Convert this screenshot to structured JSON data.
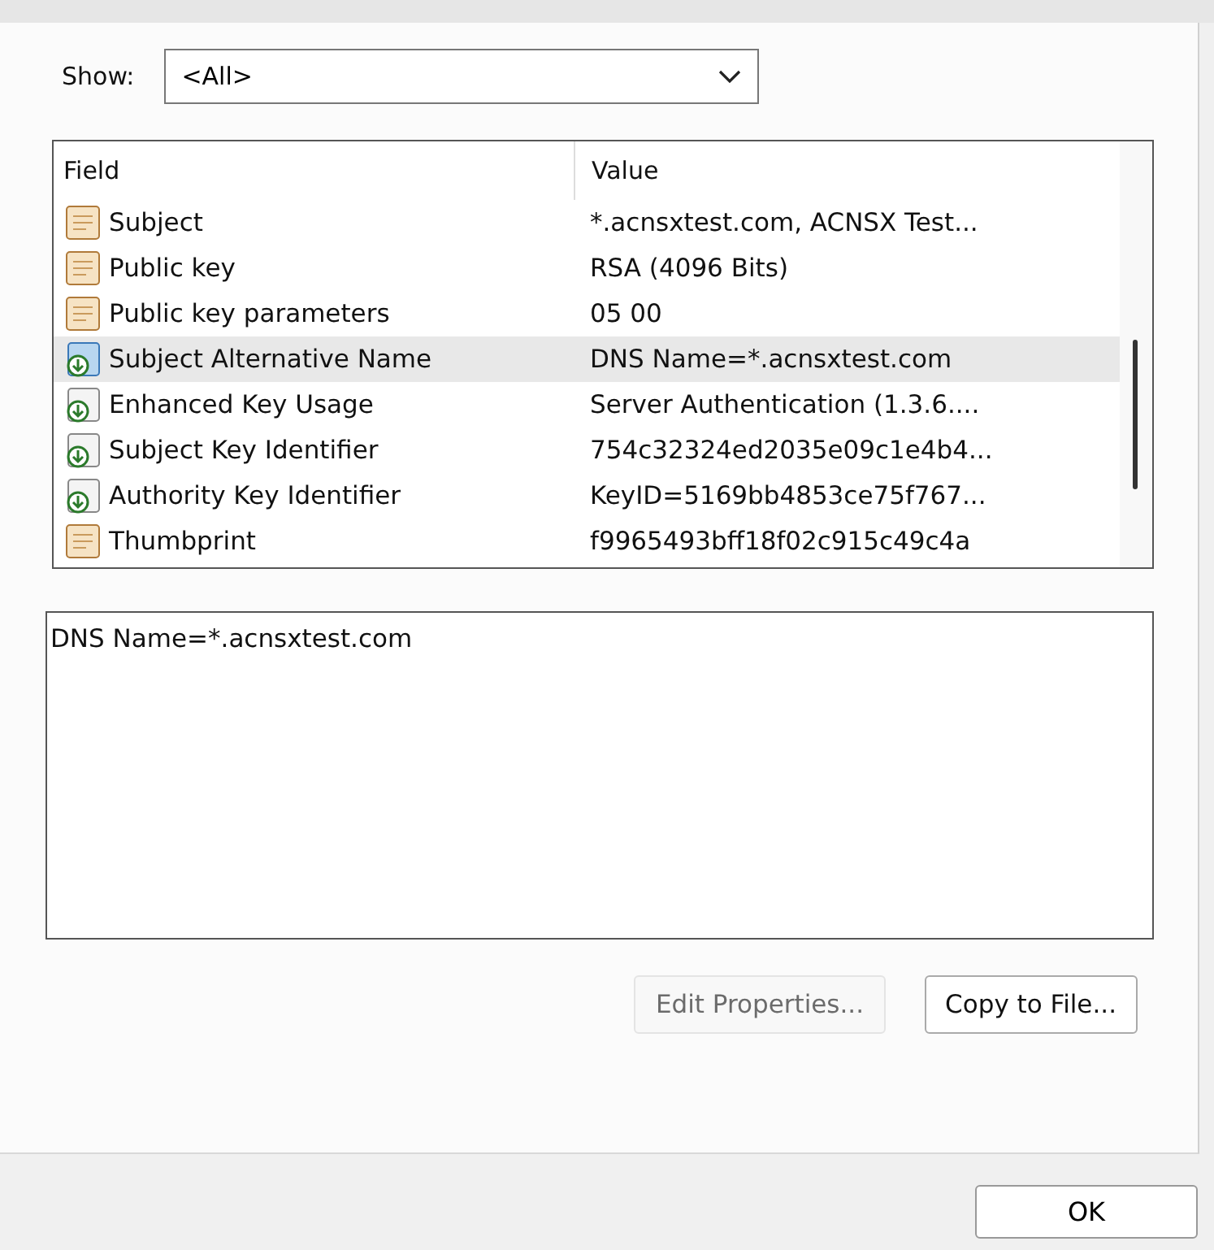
{
  "show": {
    "label": "Show:",
    "value": "<All>"
  },
  "table": {
    "columns": [
      "Field",
      "Value"
    ],
    "rows": [
      {
        "field": "Subject",
        "value": "*.acnsxtest.com, ACNSX Test...",
        "kind": "property",
        "selected": false
      },
      {
        "field": "Public key",
        "value": "RSA (4096 Bits)",
        "kind": "property",
        "selected": false
      },
      {
        "field": "Public key parameters",
        "value": "05 00",
        "kind": "property",
        "selected": false
      },
      {
        "field": "Subject Alternative Name",
        "value": "DNS Name=*.acnsxtest.com",
        "kind": "extension",
        "selected": true
      },
      {
        "field": "Enhanced Key Usage",
        "value": "Server Authentication (1.3.6....",
        "kind": "extension",
        "selected": false
      },
      {
        "field": "Subject Key Identifier",
        "value": "754c32324ed2035e09c1e4b4...",
        "kind": "extension",
        "selected": false
      },
      {
        "field": "Authority Key Identifier",
        "value": "KeyID=5169bb4853ce75f767...",
        "kind": "extension",
        "selected": false
      },
      {
        "field": "Thumbprint",
        "value": "f9965493bff18f02c915c49c4a",
        "kind": "property",
        "selected": false
      }
    ]
  },
  "detail": {
    "value": "DNS Name=*.acnsxtest.com"
  },
  "buttons": [
    {
      "label": "Edit Properties...",
      "disabled": true
    },
    {
      "label": "Copy to File...",
      "disabled": false
    }
  ],
  "ok": {
    "label": "OK"
  }
}
